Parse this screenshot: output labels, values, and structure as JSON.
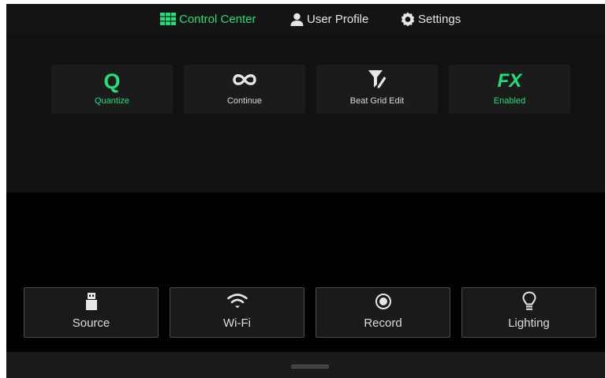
{
  "nav": {
    "tabs": [
      {
        "label": "Control Center",
        "icon": "grid-icon",
        "active": true
      },
      {
        "label": "User Profile",
        "icon": "user-icon",
        "active": false
      },
      {
        "label": "Settings",
        "icon": "gear-icon",
        "active": false
      }
    ]
  },
  "quick_tiles": [
    {
      "symbol": "Q",
      "label": "Quantize",
      "active": true
    },
    {
      "icon": "infinity-icon",
      "label": "Continue",
      "active": false
    },
    {
      "icon": "beat-grid-edit-icon",
      "label": "Beat Grid Edit",
      "active": false
    },
    {
      "symbol": "FX",
      "label": "Enabled",
      "active": true
    }
  ],
  "bottom_buttons": [
    {
      "label": "Source",
      "icon": "usb-icon"
    },
    {
      "label": "Wi-Fi",
      "icon": "wifi-icon"
    },
    {
      "label": "Record",
      "icon": "record-icon"
    },
    {
      "label": "Lighting",
      "icon": "lightbulb-icon"
    }
  ],
  "colors": {
    "accent": "#1fe07a",
    "background": "#000000",
    "panel": "#111111",
    "tile": "#1b1b1b"
  }
}
